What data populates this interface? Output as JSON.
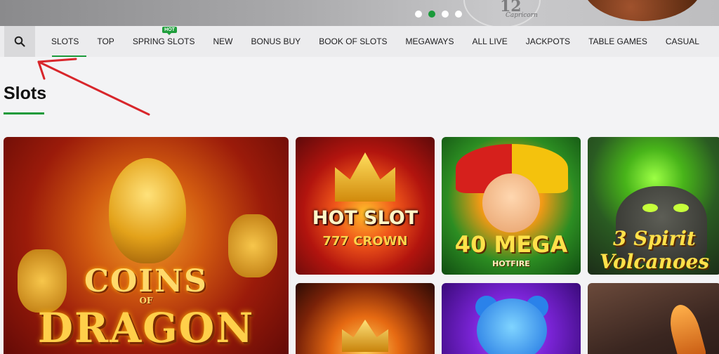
{
  "banner": {
    "clock_number": "12",
    "clock_label": "Capricorn",
    "carousel_dots": [
      false,
      true,
      false,
      false
    ]
  },
  "nav": {
    "search_label": "Search",
    "items": [
      {
        "label": "SLOTS",
        "active": true
      },
      {
        "label": "TOP"
      },
      {
        "label": "SPRING SLOTS",
        "badge": "HOT"
      },
      {
        "label": "NEW"
      },
      {
        "label": "BONUS BUY"
      },
      {
        "label": "BOOK OF SLOTS"
      },
      {
        "label": "MEGAWAYS"
      },
      {
        "label": "ALL LIVE"
      },
      {
        "label": "JACKPOTS"
      },
      {
        "label": "TABLE GAMES"
      },
      {
        "label": "CASUAL"
      }
    ]
  },
  "section": {
    "title": "Slots"
  },
  "games": [
    {
      "line1": "COINS",
      "line2": "OF",
      "line3": "DRAGON"
    },
    {
      "line1": "HOT SLOT",
      "line2": "777 CROWN"
    },
    {
      "line1": "40 MEGA",
      "line2": "HOTFIRE"
    },
    {
      "line1": "3 Spirit Volcanoes"
    },
    {
      "line1": ""
    },
    {
      "line1": ""
    },
    {
      "line1": ""
    }
  ],
  "colors": {
    "accent": "#1a9a3a",
    "annotation_arrow": "#d8262b"
  }
}
